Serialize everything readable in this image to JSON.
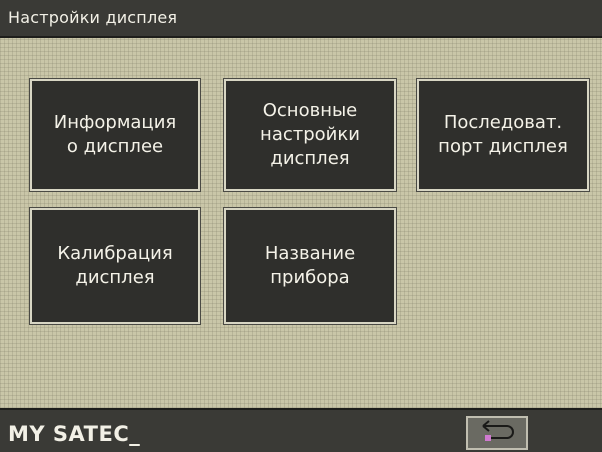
{
  "window": {
    "title": "Настройки дисплея"
  },
  "menu": {
    "tiles": [
      {
        "label": "Информация\nо дисплее"
      },
      {
        "label": "Основные\nнастройки\nдисплея"
      },
      {
        "label": "Последоват.\nпорт дисплея"
      },
      {
        "label": "Калибрация\nдисплея"
      },
      {
        "label": "Название\nприбора"
      }
    ]
  },
  "status": {
    "device_name": "MY SATEC_",
    "back_icon": "return-arrow-icon"
  },
  "colors": {
    "screen_bg": "#c9c6a8",
    "bar_bg": "#3a3a36",
    "tile_bg": "#2f2f2c",
    "tile_text": "#f4f2e8"
  }
}
